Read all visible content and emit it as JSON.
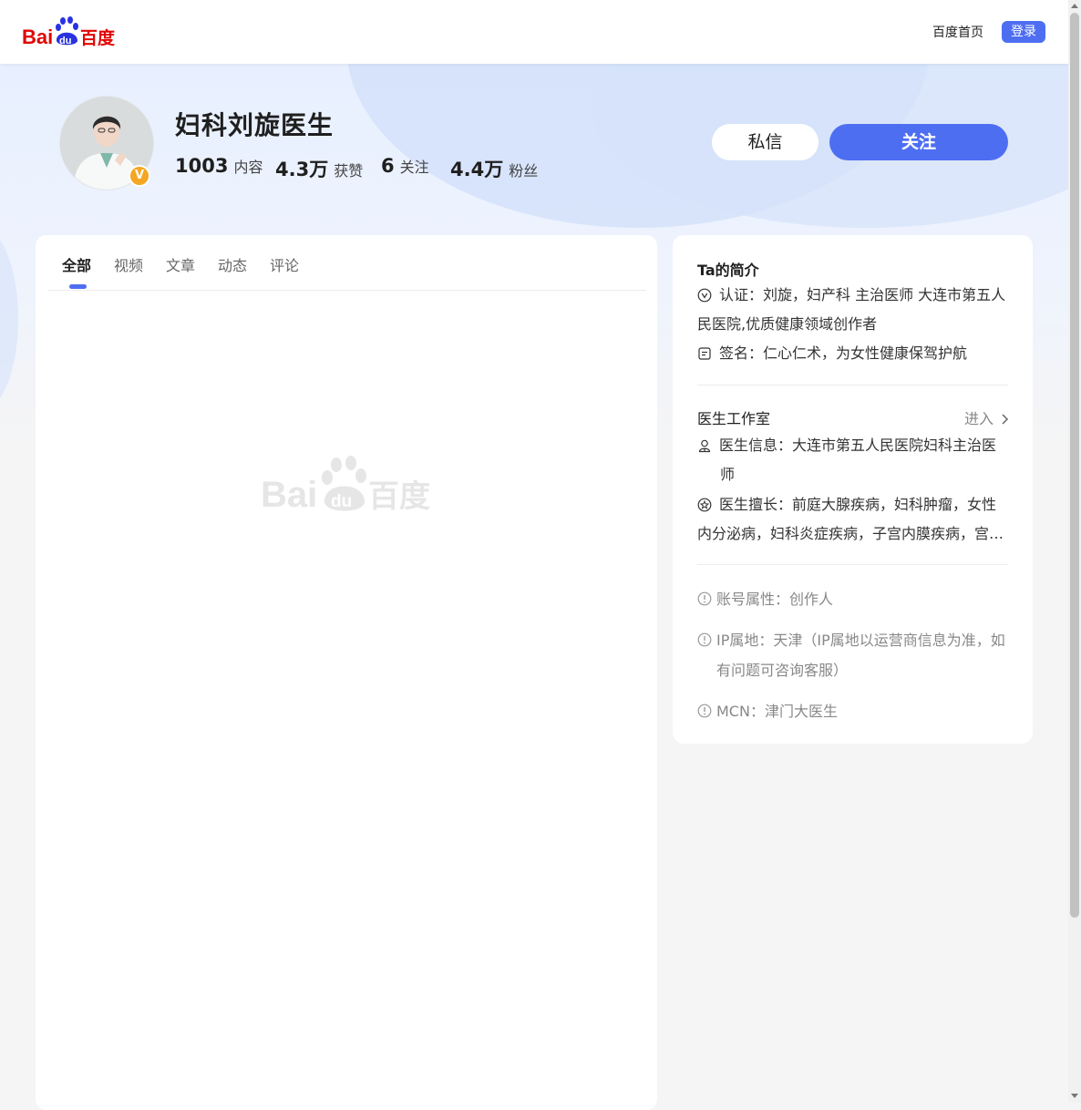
{
  "header": {
    "logo_alt": "Baidu 百度",
    "home_link": "百度首页",
    "login_label": "登录"
  },
  "profile": {
    "name": "妇科刘旋医生",
    "verified_badge": "V",
    "stats": [
      {
        "value": "1003",
        "label": "内容"
      },
      {
        "value": "4.3万",
        "label": "获赞"
      },
      {
        "value": "6",
        "label": "关注"
      },
      {
        "value": "4.4万",
        "label": "粉丝"
      }
    ],
    "message_label": "私信",
    "follow_label": "关注"
  },
  "tabs": {
    "items": [
      "全部",
      "视频",
      "文章",
      "动态",
      "评论"
    ],
    "active": "全部"
  },
  "sidebar": {
    "intro_title": "Ta的简介",
    "certification": "认证：刘旋，妇产科 主治医师 大连市第五人民医院,优质健康领域创作者",
    "signature": "签名：仁心仁术，为女性健康保驾护航",
    "studio_title": "医生工作室",
    "enter_label": "进入",
    "doctor_info": "医生信息：大连市第五人民医院妇科主治医师",
    "doctor_specialty": "医生擅长：前庭大腺疾病，妇科肿瘤，女性内分泌病，妇科炎症疾病，子宫内膜疾病，宫…",
    "account_type": "账号属性：创作人",
    "ip_location": "IP属地：天津（IP属地以运营商信息为准，如有问题可咨询客服）",
    "mcn": "MCN：津门大医生"
  },
  "colors": {
    "accent": "#4e6ef2",
    "badge": "#f5a623",
    "logo_red": "#e10602",
    "logo_blue": "#2932e1"
  },
  "icons": [
    "baidu-logo",
    "verified-icon",
    "v-circle-icon",
    "note-icon",
    "doctor-icon",
    "star-circle-icon",
    "info-circle-icon",
    "chevron-right-icon"
  ]
}
